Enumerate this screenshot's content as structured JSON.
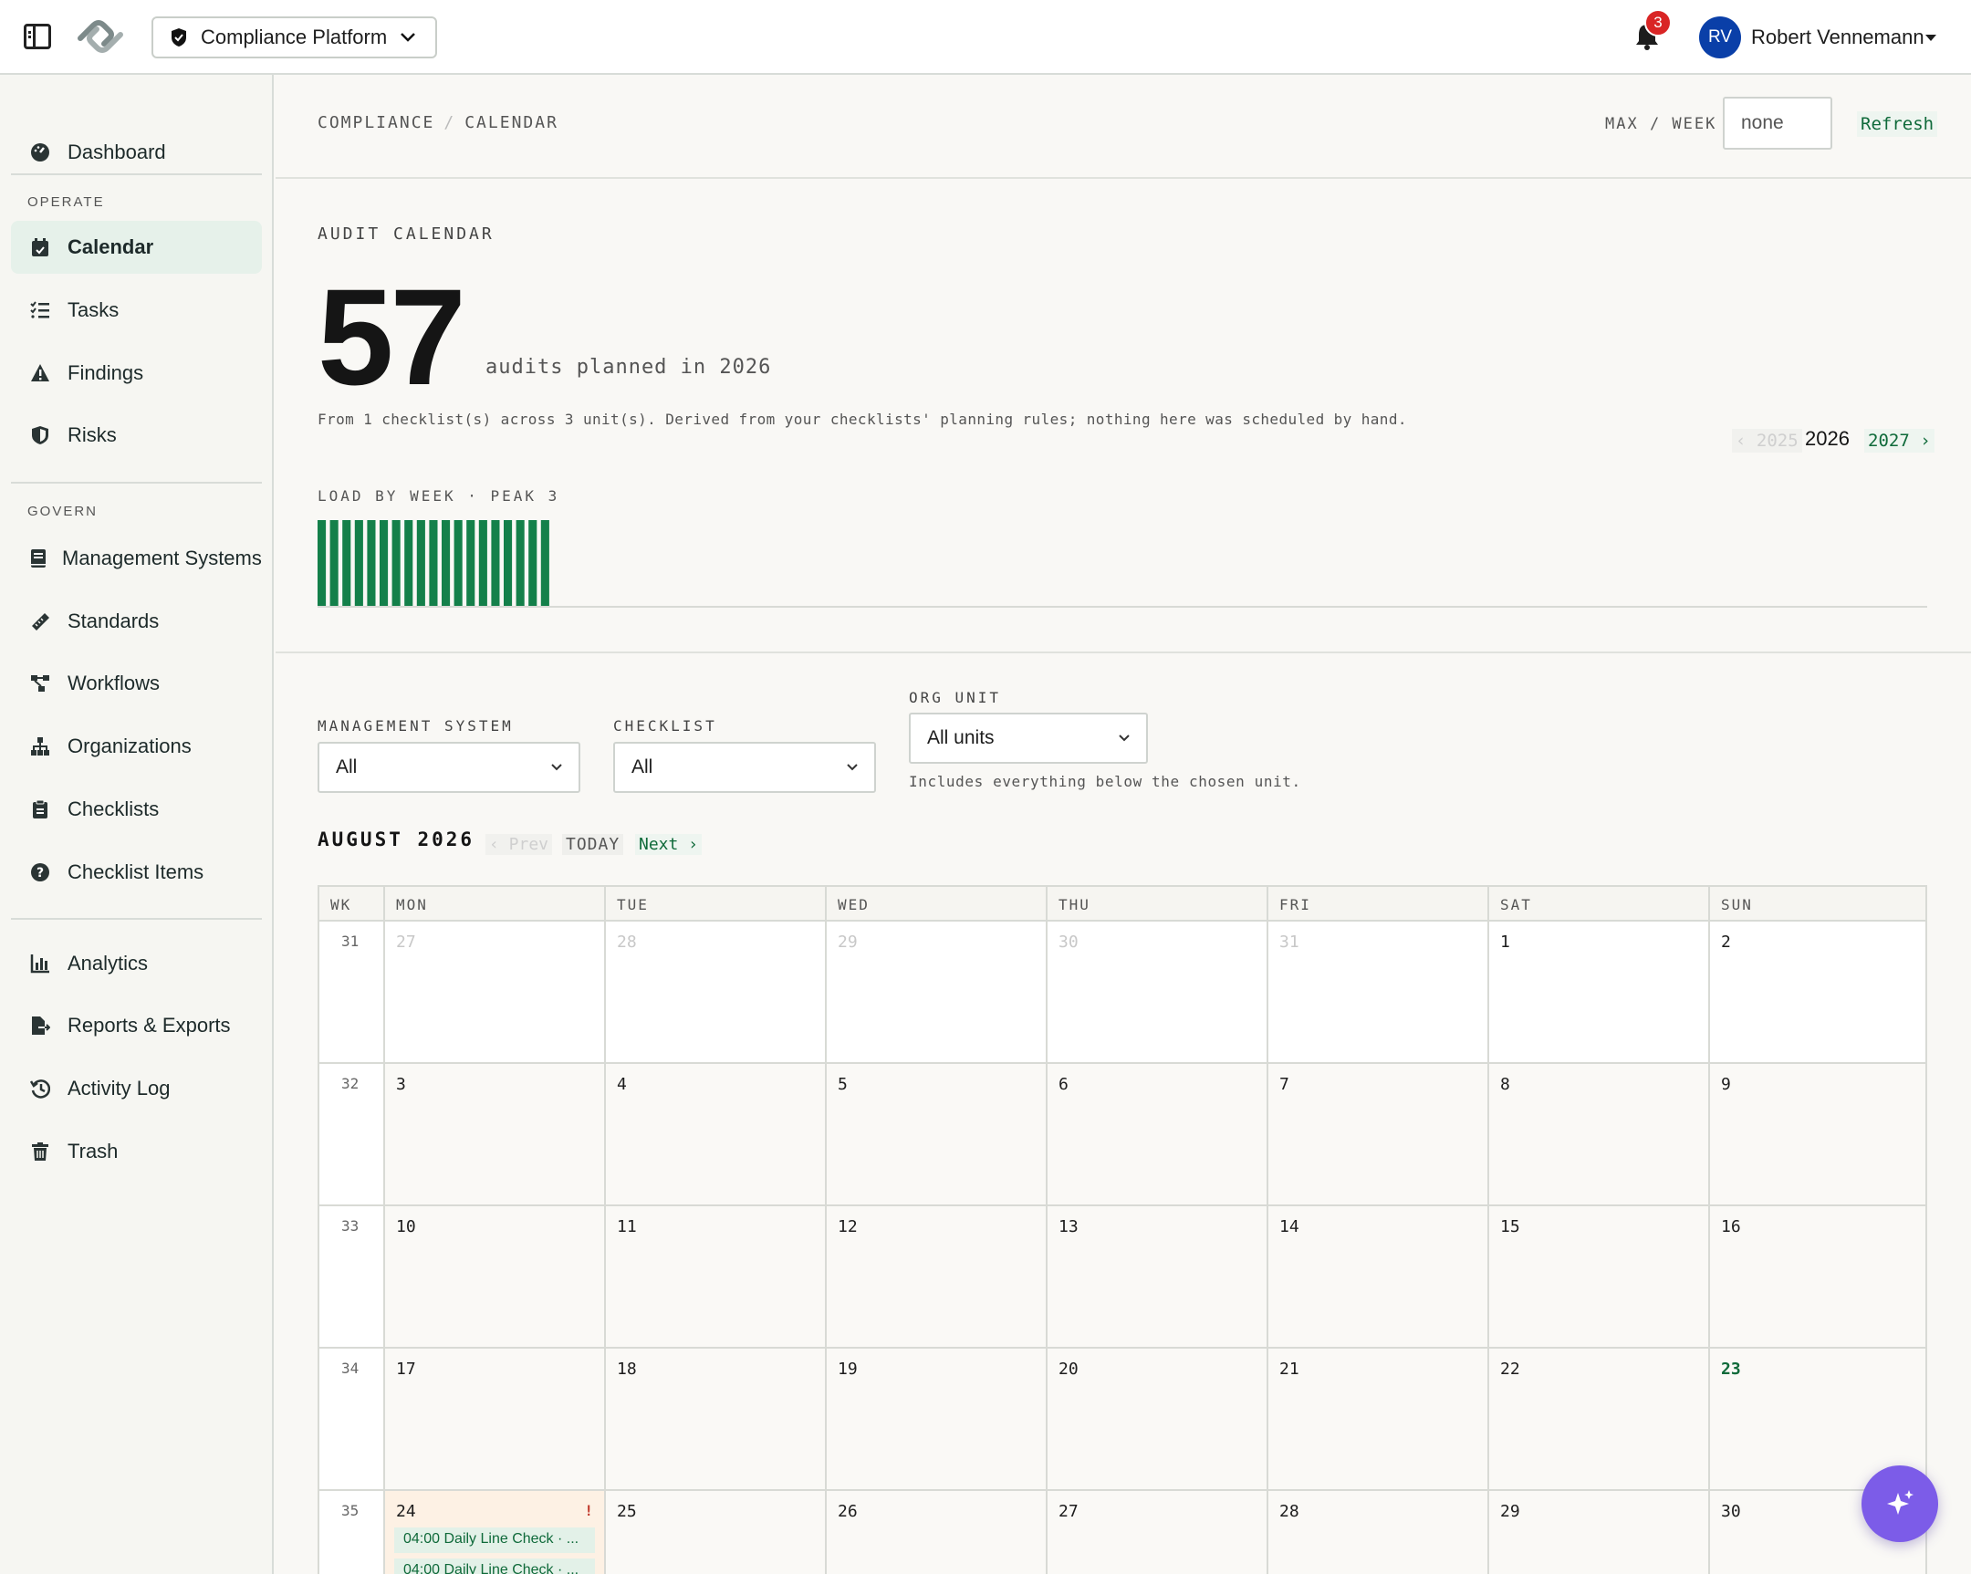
{
  "topbar": {
    "platform_label": "Compliance Platform",
    "notifications_count": "3",
    "user_initials": "RV",
    "user_name": "Robert Vennemann"
  },
  "sidebar": {
    "dashboard": "Dashboard",
    "section_operate": "OPERATE",
    "operate_items": [
      "Calendar",
      "Tasks",
      "Findings",
      "Risks"
    ],
    "section_govern": "GOVERN",
    "govern_items": [
      "Management Systems",
      "Standards",
      "Workflows",
      "Organizations",
      "Checklists",
      "Checklist Items"
    ],
    "other_items": [
      "Analytics",
      "Reports & Exports",
      "Activity Log",
      "Trash"
    ]
  },
  "breadcrumb": {
    "root": "COMPLIANCE",
    "sep": "/",
    "current": "CALENDAR"
  },
  "toolbar": {
    "maxweek_label": "MAX / WEEK",
    "maxweek_value": "none",
    "refresh_label": "Refresh"
  },
  "summary": {
    "label": "AUDIT CALENDAR",
    "count": "57",
    "caption": "audits planned in 2026",
    "derived_text": "From 1 checklist(s) across 3 unit(s). Derived from your checklists' planning rules; nothing here was scheduled by hand."
  },
  "year_nav": {
    "prev": "‹ 2025",
    "current": "2026",
    "next": "2027 ›"
  },
  "load": {
    "label": "LOAD BY WEEK · PEAK 3",
    "bar_color": "#14804a",
    "weeks_total": 53,
    "weeks_with_load": 19,
    "peak": 3
  },
  "filters": {
    "mgmt_label": "MANAGEMENT SYSTEM",
    "mgmt_value": "All",
    "checklist_label": "CHECKLIST",
    "checklist_value": "All",
    "org_label": "ORG UNIT",
    "org_value": "All units",
    "org_help": "Includes everything below the chosen unit."
  },
  "month": {
    "title": "AUGUST 2026",
    "prev": "‹ Prev",
    "today": "TODAY",
    "next": "Next ›"
  },
  "calendar": {
    "headers": [
      "WK",
      "MON",
      "TUE",
      "WED",
      "THU",
      "FRI",
      "SAT",
      "SUN"
    ],
    "rows": [
      {
        "wk": "31",
        "days": [
          "27",
          "28",
          "29",
          "30",
          "31",
          "1",
          "2"
        ]
      },
      {
        "wk": "32",
        "days": [
          "3",
          "4",
          "5",
          "6",
          "7",
          "8",
          "9"
        ]
      },
      {
        "wk": "33",
        "days": [
          "10",
          "11",
          "12",
          "13",
          "14",
          "15",
          "16"
        ]
      },
      {
        "wk": "34",
        "days": [
          "17",
          "18",
          "19",
          "20",
          "21",
          "22",
          "23"
        ]
      },
      {
        "wk": "35",
        "days": [
          "24",
          "25",
          "26",
          "27",
          "28",
          "29",
          "30"
        ]
      }
    ],
    "flag_mark": "!",
    "events": [
      "04:00 Daily Line Check · ...",
      "04:00 Daily Line Check · ..."
    ]
  },
  "colors": {
    "accent": "#0f6a3a",
    "fab": "#7c5ce8",
    "badge": "#d92525",
    "avatar": "#0a3fa8"
  }
}
